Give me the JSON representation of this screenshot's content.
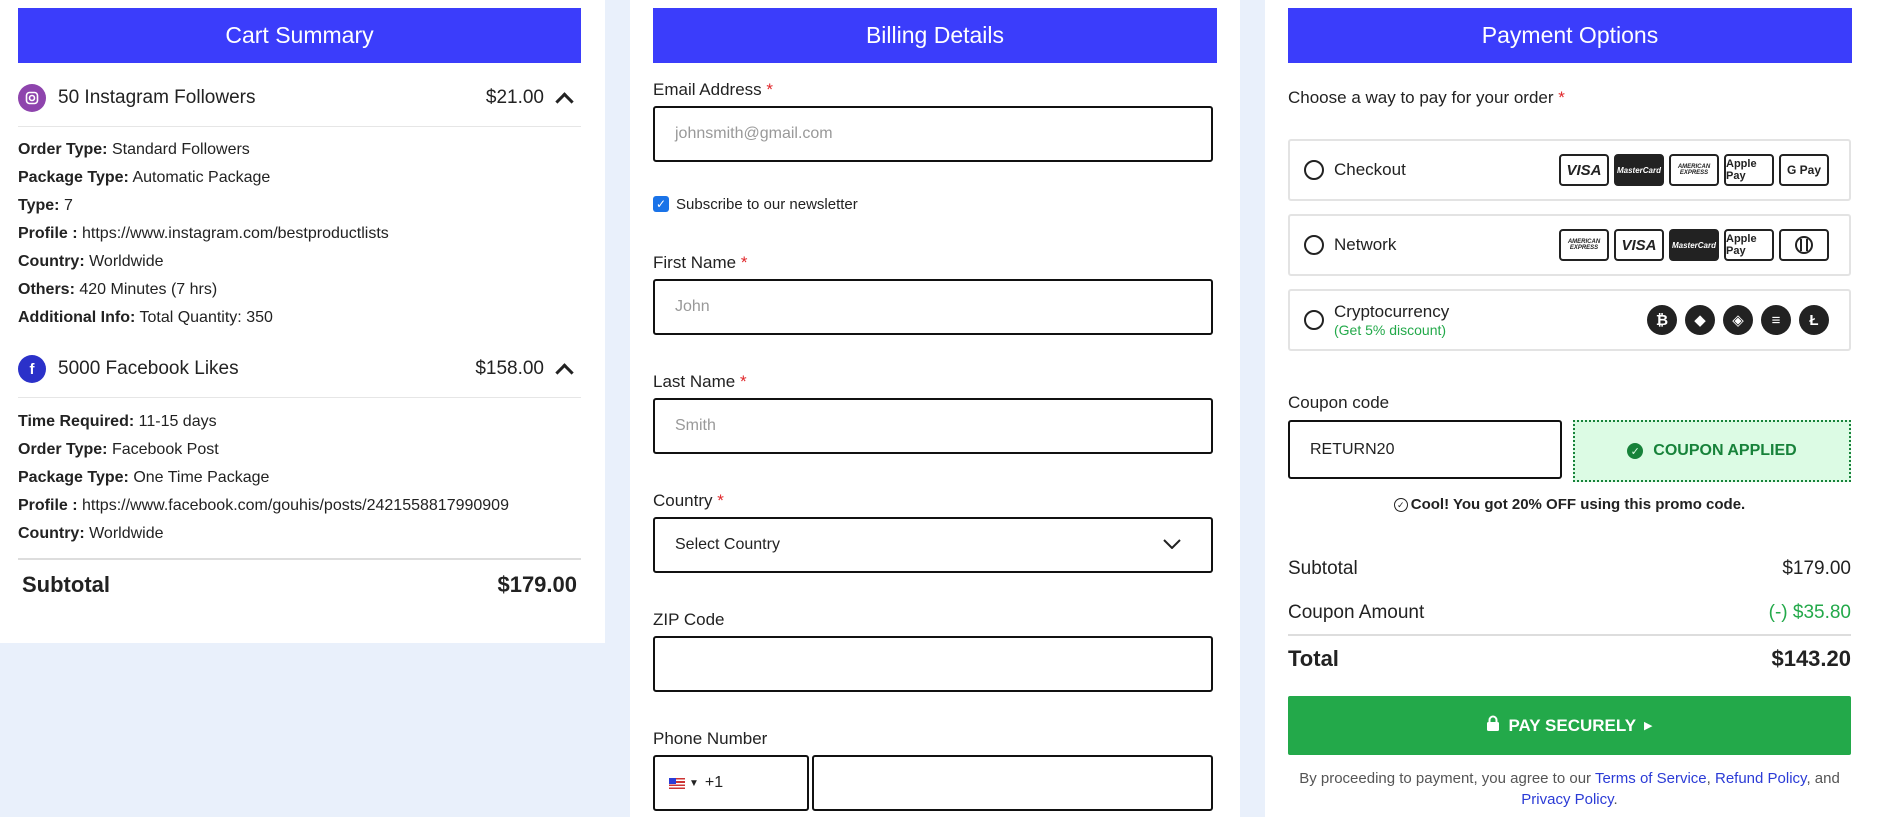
{
  "cart": {
    "title": "Cart Summary",
    "items": [
      {
        "name": "50 Instagram Followers",
        "price": "$21.00",
        "icon": "instagram-icon",
        "icon_color": "#8e44ad",
        "details": [
          {
            "label": "Order Type:",
            "value": "Standard Followers"
          },
          {
            "label": "Package Type:",
            "value": "Automatic Package"
          },
          {
            "label": "Type:",
            "value": "7"
          },
          {
            "label": "Profile :",
            "value": "https://www.instagram.com/bestproductlists"
          },
          {
            "label": "Country:",
            "value": "Worldwide"
          },
          {
            "label": "Others:",
            "value": "420 Minutes (7 hrs)"
          },
          {
            "label": "Additional Info:",
            "value": "Total Quantity: 350"
          }
        ]
      },
      {
        "name": "5000 Facebook Likes",
        "price": "$158.00",
        "icon": "facebook-icon",
        "icon_color": "#2b31c9",
        "details": [
          {
            "label": "Time Required:",
            "value": "11-15 days"
          },
          {
            "label": "Order Type:",
            "value": "Facebook Post"
          },
          {
            "label": "Package Type:",
            "value": "One Time Package"
          },
          {
            "label": "Profile :",
            "value": "https://www.facebook.com/gouhis/posts/2421558817990909"
          },
          {
            "label": "Country:",
            "value": "Worldwide"
          }
        ]
      }
    ],
    "subtotal_label": "Subtotal",
    "subtotal_value": "$179.00"
  },
  "billing": {
    "title": "Billing Details",
    "email_label": "Email Address",
    "email_placeholder": "johnsmith@gmail.com",
    "newsletter_label": "Subscribe to our newsletter",
    "newsletter_checked": true,
    "first_name_label": "First Name",
    "first_name_placeholder": "John",
    "last_name_label": "Last Name",
    "last_name_placeholder": "Smith",
    "country_label": "Country",
    "country_value": "Select Country",
    "zip_label": "ZIP Code",
    "phone_label": "Phone Number",
    "phone_code": "+1",
    "required_mark": "*"
  },
  "payment": {
    "title": "Payment Options",
    "choose_label": "Choose a way to pay for your order",
    "options": [
      {
        "name": "Checkout",
        "cards": [
          "VISA",
          "MasterCard",
          "AMERICAN EXPRESS",
          "Apple Pay",
          "G Pay"
        ]
      },
      {
        "name": "Network",
        "cards": [
          "AMERICAN EXPRESS",
          "VISA",
          "MasterCard",
          "Apple Pay",
          "Diners"
        ]
      },
      {
        "name": "Cryptocurrency",
        "note": "(Get 5% discount)",
        "coins": [
          "bitcoin-icon",
          "ethereum-icon",
          "binance-icon",
          "solana-icon",
          "litecoin-icon"
        ]
      }
    ],
    "coupon_label": "Coupon code",
    "coupon_value": "RETURN20",
    "coupon_applied": "COUPON APPLIED",
    "coupon_msg": "Cool! You got 20% OFF using this promo code.",
    "subtotal_label": "Subtotal",
    "subtotal_value": "$179.00",
    "coupon_amount_label": "Coupon Amount",
    "coupon_amount_value": "(-) $35.80",
    "total_label": "Total",
    "total_value": "$143.20",
    "pay_button": "PAY SECURELY",
    "terms_prefix": "By proceeding to payment, you agree to our",
    "terms_link": "Terms of Service",
    "refund_link": "Refund Policy",
    "and_text": ", and",
    "privacy_link": "Privacy Policy",
    "accent": "#3b3dfb",
    "success": "#23a94a"
  }
}
